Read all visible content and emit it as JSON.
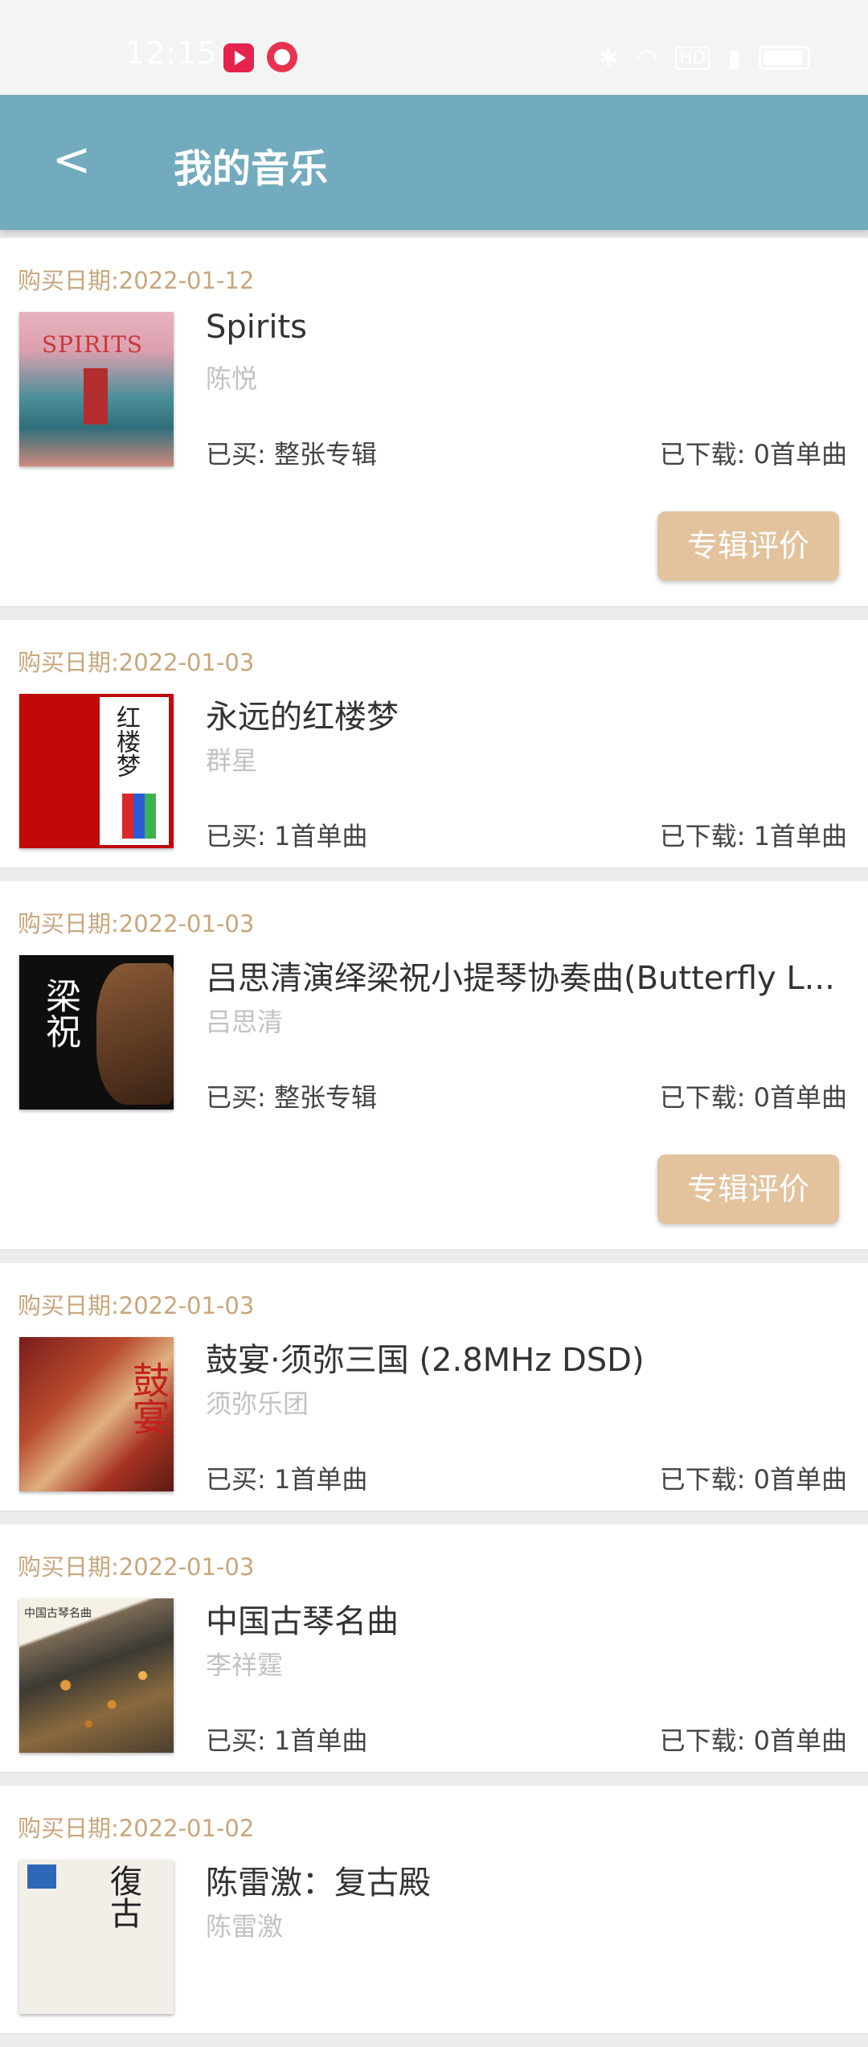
{
  "status_bar": {
    "time": "12:15",
    "icons": [
      "video-app-icon",
      "chat-app-icon",
      "bluetooth-icon",
      "wifi-icon",
      "hd-icon",
      "signal-icon",
      "battery-icon"
    ]
  },
  "header": {
    "back_label": "<",
    "title": "我的音乐"
  },
  "colors": {
    "header_bg": "#73abbe",
    "date_text": "#c8a67d",
    "review_button": "#e2c39d"
  },
  "albums": [
    {
      "date": "购买日期:2022-01-12",
      "title": "Spirits",
      "artist": "陈悦",
      "bought": "已买: 整张专辑",
      "downloaded": "已下载: 0首单曲",
      "review_label": "专辑评价",
      "cover_text": "SPIRITS"
    },
    {
      "date": "购买日期:2022-01-03",
      "title": "永远的红楼梦",
      "artist": "群星",
      "bought": "已买: 1首单曲",
      "downloaded": "已下载: 1首单曲",
      "cover_text": "红楼梦"
    },
    {
      "date": "购买日期:2022-01-03",
      "title": "吕思清演绎梁祝小提琴协奏曲(Butterfly L...",
      "artist": "吕思清",
      "bought": "已买: 整张专辑",
      "downloaded": "已下载: 0首单曲",
      "review_label": "专辑评价",
      "cover_text": "梁祝"
    },
    {
      "date": "购买日期:2022-01-03",
      "title": "鼓宴·须弥三国 (2.8MHz DSD)",
      "artist": "须弥乐团",
      "bought": "已买: 1首单曲",
      "downloaded": "已下载: 0首单曲",
      "cover_text": "鼓宴"
    },
    {
      "date": "购买日期:2022-01-03",
      "title": "中国古琴名曲",
      "artist": "李祥霆",
      "bought": "已买: 1首单曲",
      "downloaded": "已下载: 0首单曲",
      "cover_text": "中国古琴名曲"
    },
    {
      "date": "购买日期:2022-01-02",
      "title": "陈雷激：复古殿",
      "artist": "陈雷激",
      "cover_text": "復古"
    }
  ]
}
